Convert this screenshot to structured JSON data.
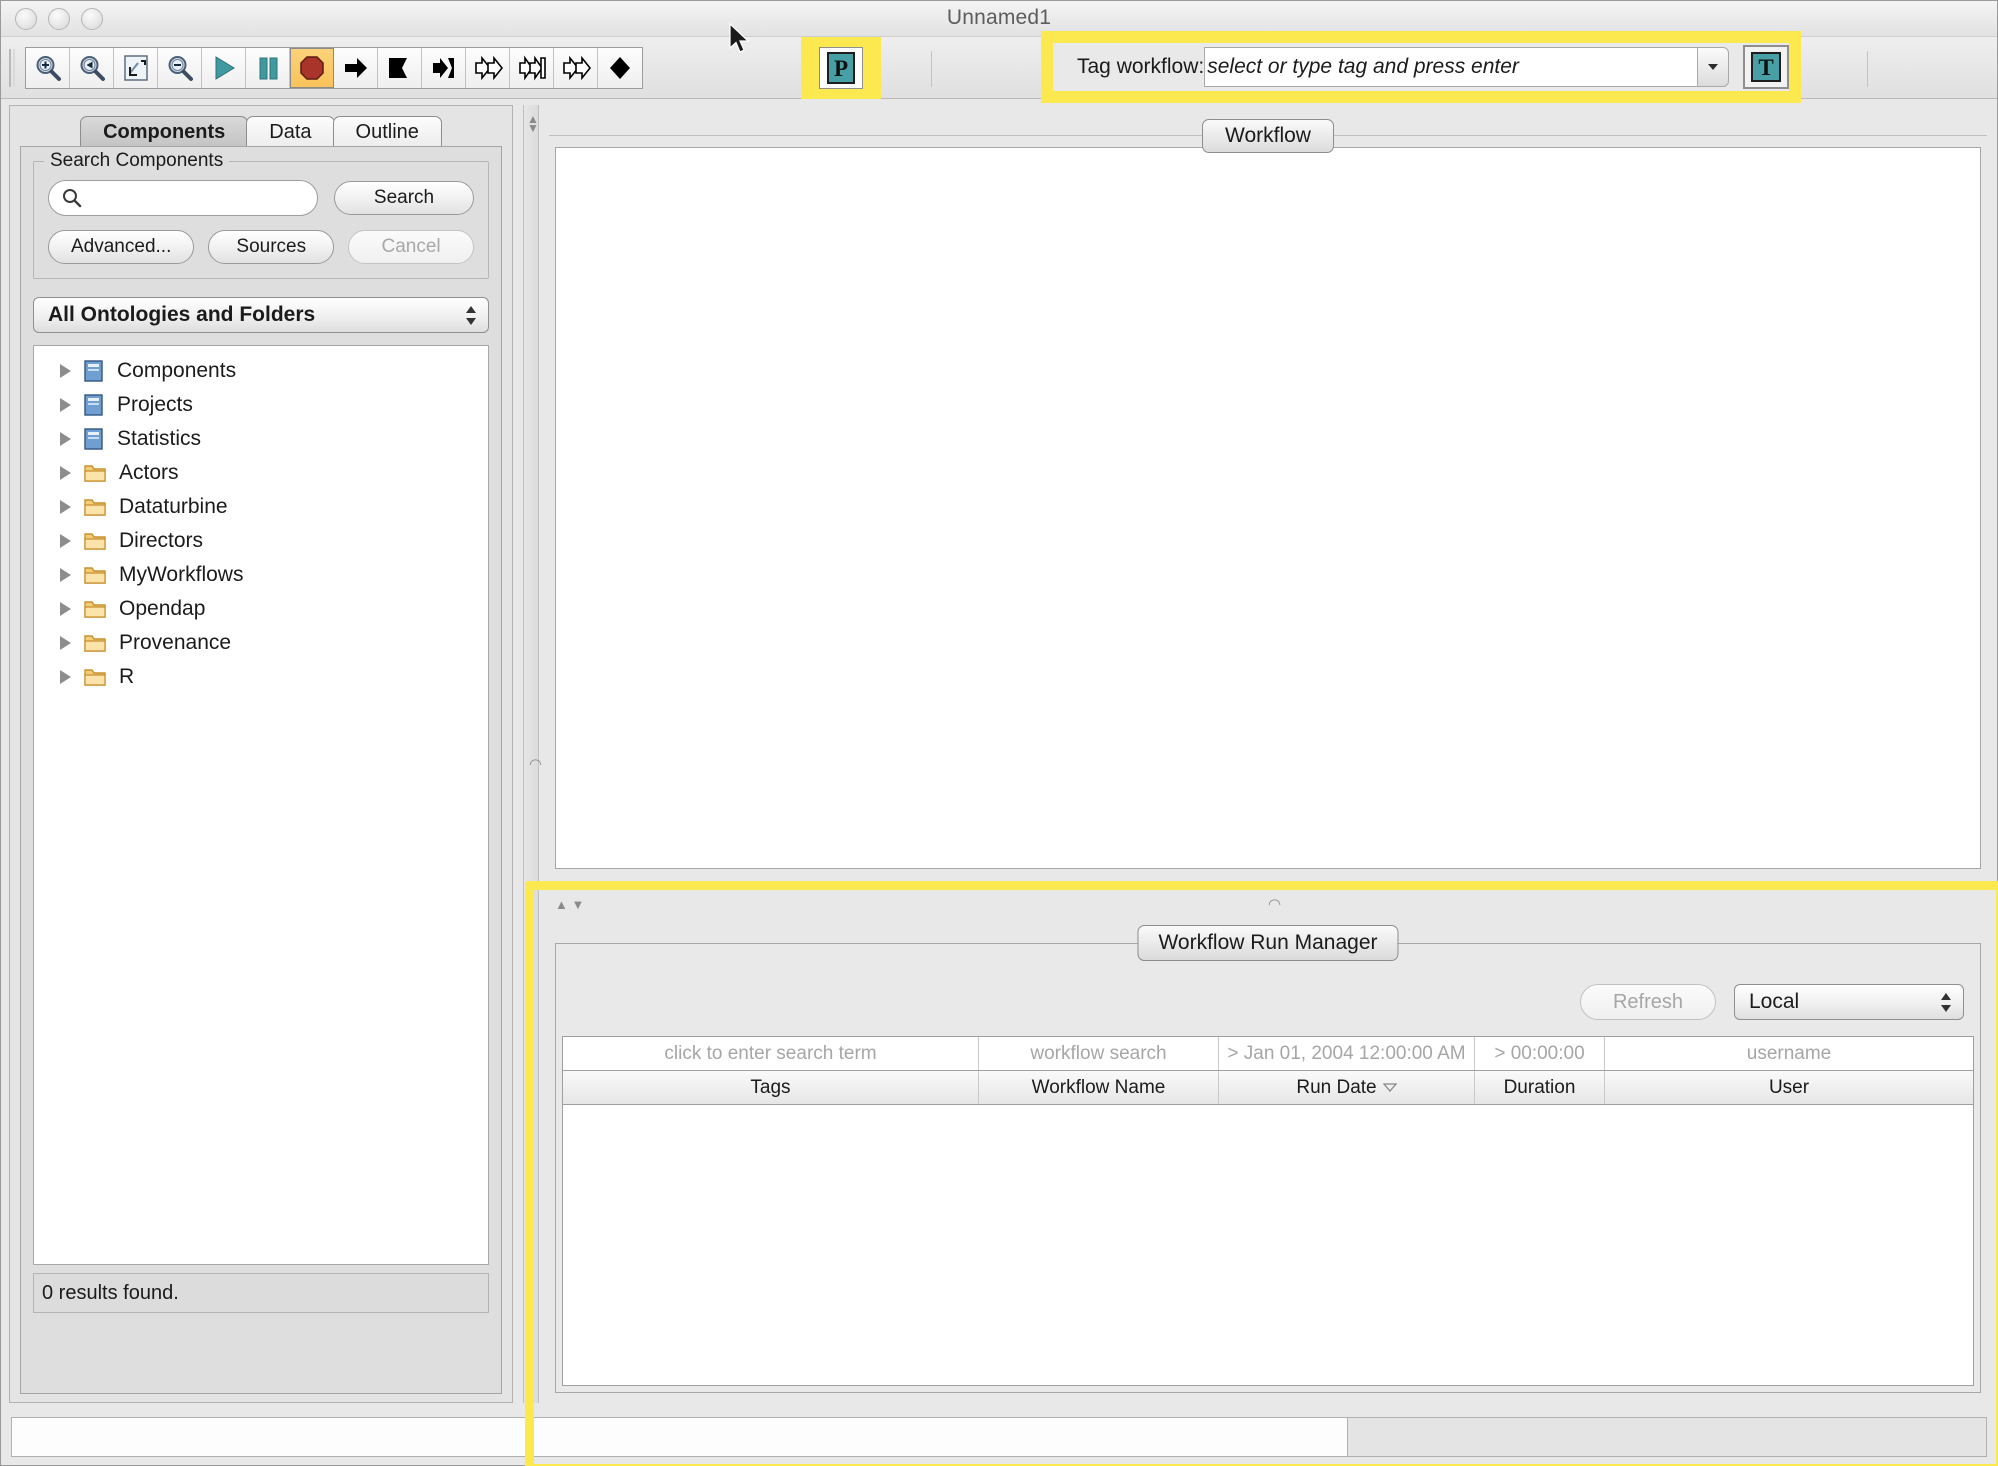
{
  "window": {
    "title": "Unnamed1",
    "traffic_lights": [
      "close-button",
      "minimize-button",
      "zoom-button"
    ]
  },
  "toolbar": {
    "buttons": [
      {
        "name": "zoom-in-icon",
        "glyph": "zoom-in"
      },
      {
        "name": "zoom-back-icon",
        "glyph": "zoom-back"
      },
      {
        "name": "zoom-fit-icon",
        "glyph": "zoom-fit"
      },
      {
        "name": "zoom-out-icon",
        "glyph": "zoom-out"
      },
      {
        "name": "run-icon",
        "glyph": "play"
      },
      {
        "name": "pause-icon",
        "glyph": "pause"
      },
      {
        "name": "stop-icon",
        "glyph": "stop"
      },
      {
        "name": "step-icon",
        "glyph": "arrow-right"
      },
      {
        "name": "run-to-icon",
        "glyph": "arrow-flag"
      },
      {
        "name": "step-into-icon",
        "glyph": "arrow-notch"
      },
      {
        "name": "step-over-icon",
        "glyph": "double-arrow"
      },
      {
        "name": "step-out-icon",
        "glyph": "double-arrow-notch"
      },
      {
        "name": "resume-icon",
        "glyph": "double-arrow-outline"
      },
      {
        "name": "breakpoint-icon",
        "glyph": "diamond"
      }
    ],
    "provenance_button_label": "P",
    "tag_button_label": "T"
  },
  "tag_workflow": {
    "label": "Tag workflow:",
    "placeholder": "select or type tag and press enter",
    "value": ""
  },
  "left_panel": {
    "tabs": [
      {
        "label": "Components",
        "active": true
      },
      {
        "label": "Data",
        "active": false
      },
      {
        "label": "Outline",
        "active": false
      }
    ],
    "search_group_title": "Search Components",
    "search_input_value": "",
    "search_button": "Search",
    "advanced_button": "Advanced...",
    "sources_button": "Sources",
    "cancel_button": "Cancel",
    "ontology_select": "All Ontologies and Folders",
    "tree_items": [
      {
        "label": "Components",
        "icon": "book-icon"
      },
      {
        "label": "Projects",
        "icon": "book-icon"
      },
      {
        "label": "Statistics",
        "icon": "book-icon"
      },
      {
        "label": "Actors",
        "icon": "folder-icon"
      },
      {
        "label": "Dataturbine",
        "icon": "folder-icon"
      },
      {
        "label": "Directors",
        "icon": "folder-icon"
      },
      {
        "label": "MyWorkflows",
        "icon": "folder-icon"
      },
      {
        "label": "Opendap",
        "icon": "folder-icon"
      },
      {
        "label": "Provenance",
        "icon": "folder-icon"
      },
      {
        "label": "R",
        "icon": "folder-icon"
      }
    ],
    "results_status": "0 results found."
  },
  "canvas": {
    "tab_label": "Workflow"
  },
  "run_manager": {
    "tab_label": "Workflow Run Manager",
    "refresh_button": "Refresh",
    "source_select": "Local",
    "filters": [
      "click to enter search term",
      "workflow search",
      "> Jan 01, 2004 12:00:00 AM",
      "> 00:00:00",
      "username"
    ],
    "columns": [
      "Tags",
      "Workflow Name",
      "Run Date",
      "Duration",
      "User"
    ],
    "sort_column": "Run Date",
    "sort_indicator": "descending",
    "rows": []
  },
  "colors": {
    "highlight": "#fbe94f",
    "teal": "#46a0a6",
    "stop_red": "#a8342a",
    "stop_bg": "#f9c35a"
  }
}
